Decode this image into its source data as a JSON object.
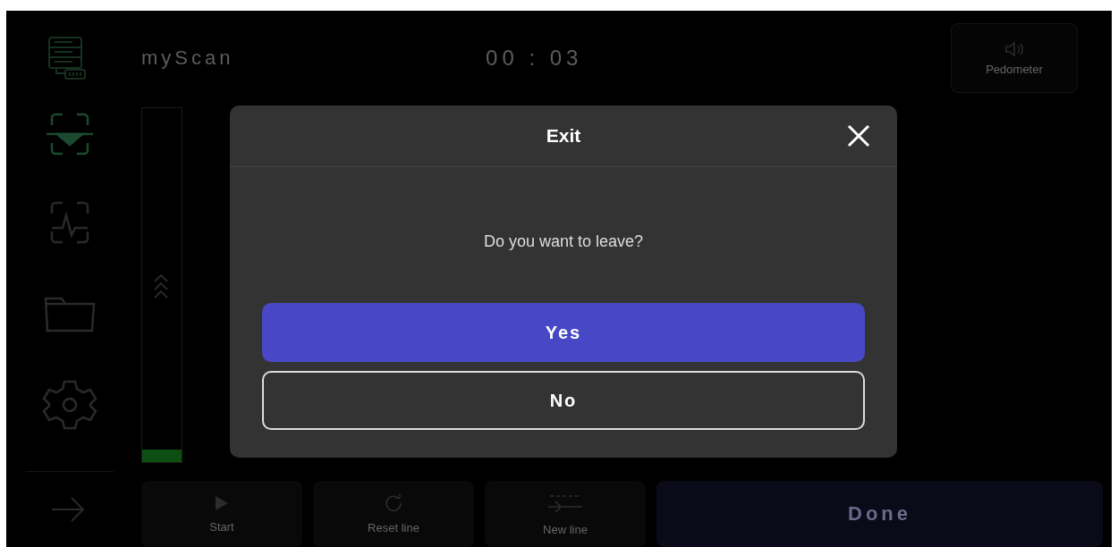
{
  "header": {
    "app_title": "myScan",
    "timer": "00 : 03",
    "pedometer_button": {
      "label": "Pedometer"
    }
  },
  "sidebar": {
    "items": [
      {
        "kind": "scan",
        "selected": true
      },
      {
        "kind": "pulse",
        "selected": false
      },
      {
        "kind": "folder",
        "selected": false
      },
      {
        "kind": "settings",
        "selected": false
      }
    ]
  },
  "level_bar": {
    "level": 0.035
  },
  "dialog": {
    "title": "Exit",
    "message": "Do you want to leave?",
    "buttons": [
      {
        "label": "Yes",
        "kind": "primary"
      },
      {
        "label": "No",
        "kind": "secondary"
      }
    ]
  },
  "bottom_bar": {
    "buttons": [
      {
        "label": "Start",
        "kind": "play"
      },
      {
        "label": "Reset line",
        "kind": "reset"
      },
      {
        "label": "New line",
        "kind": "newline"
      },
      {
        "label": "Done",
        "kind": "done"
      }
    ]
  }
}
